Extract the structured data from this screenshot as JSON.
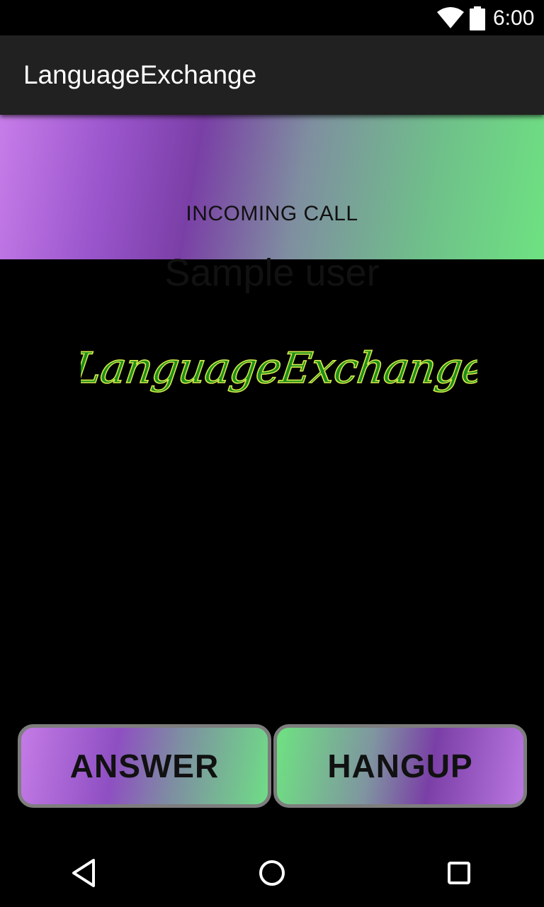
{
  "status_bar": {
    "time": "6:00",
    "wifi_icon": "wifi-icon",
    "battery_icon": "battery-icon"
  },
  "app_bar": {
    "title": "LanguageExchange"
  },
  "call": {
    "caller_name": "Sample user",
    "status": "INCOMING CALL"
  },
  "logo": {
    "text": "LanguageExchange",
    "fill_color": "#1a8f1a",
    "outline_color": "#d6e84a"
  },
  "buttons": {
    "answer_label": "ANSWER",
    "hangup_label": "HANGUP"
  },
  "nav_bar": {
    "back_icon": "back-triangle-icon",
    "home_icon": "home-circle-icon",
    "recent_icon": "recent-apps-square-icon"
  },
  "colors": {
    "purple": "#7a3fa6",
    "lilac": "#c77de9",
    "green": "#6ee281",
    "app_bar": "#212121"
  }
}
